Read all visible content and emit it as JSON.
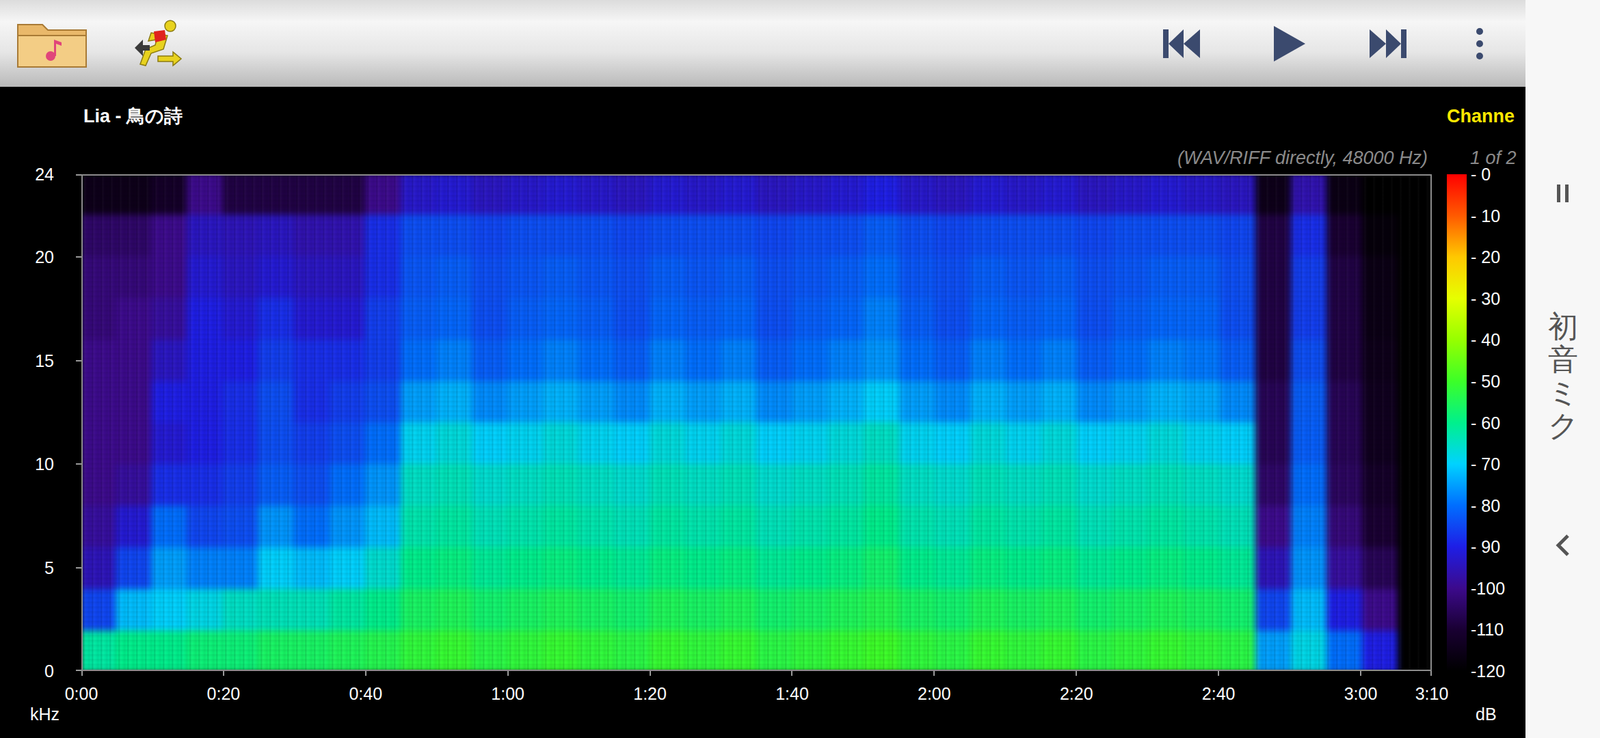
{
  "title": "Lia - 鳥の詩",
  "channel_label": "Channe",
  "source_info": "(WAV/RIFF directly, 48000 Hz)",
  "channel_index": "1 of 2",
  "chart": {
    "y_axis": {
      "unit": "kHz",
      "ticks": [
        "24",
        "20",
        "15",
        "10",
        "5",
        "0"
      ]
    },
    "x_axis": {
      "ticks": [
        "0:00",
        "0:20",
        "0:40",
        "1:00",
        "1:20",
        "1:40",
        "2:00",
        "2:20",
        "2:40",
        "3:00",
        "3:10"
      ]
    },
    "colorbar": {
      "unit": "dB",
      "ticks": [
        "- 0",
        "- 10",
        "- 20",
        "- 30",
        "- 40",
        "- 50",
        "- 60",
        "- 70",
        "- 80",
        "- 90",
        "-100",
        "-110",
        "-120"
      ]
    },
    "spectrogram": {
      "columns": [
        [
          -62,
          -85,
          -95,
          -98,
          -100,
          -100,
          -100,
          -100,
          -102,
          -102,
          -104,
          -115
        ],
        [
          -60,
          -72,
          -85,
          -92,
          -98,
          -100,
          -100,
          -100,
          -100,
          -102,
          -104,
          -115
        ],
        [
          -60,
          -70,
          -75,
          -80,
          -88,
          -92,
          -90,
          -94,
          -98,
          -100,
          -100,
          -112
        ],
        [
          -58,
          -68,
          -78,
          -85,
          -88,
          -90,
          -90,
          -90,
          -90,
          -92,
          -94,
          -100
        ],
        [
          -58,
          -65,
          -78,
          -84,
          -86,
          -88,
          -88,
          -90,
          -92,
          -94,
          -95,
          -108
        ],
        [
          -56,
          -64,
          -70,
          -76,
          -82,
          -84,
          -84,
          -86,
          -88,
          -92,
          -94,
          -108
        ],
        [
          -56,
          -64,
          -72,
          -80,
          -84,
          -86,
          -88,
          -88,
          -92,
          -94,
          -96,
          -108
        ],
        [
          -55,
          -62,
          -70,
          -76,
          -80,
          -84,
          -86,
          -88,
          -92,
          -94,
          -96,
          -108
        ],
        [
          -54,
          -60,
          -66,
          -72,
          -76,
          -80,
          -84,
          -86,
          -86,
          -88,
          -88,
          -100
        ],
        [
          -52,
          -56,
          -60,
          -63,
          -65,
          -69,
          -75,
          -80,
          -82,
          -83,
          -84,
          -93
        ],
        [
          -51,
          -55,
          -59,
          -62,
          -64,
          -67,
          -73,
          -78,
          -81,
          -82,
          -84,
          -92
        ],
        [
          -53,
          -57,
          -61,
          -64,
          -66,
          -70,
          -77,
          -82,
          -84,
          -84,
          -85,
          -94
        ],
        [
          -52,
          -56,
          -60,
          -63,
          -65,
          -69,
          -75,
          -80,
          -82,
          -83,
          -84,
          -93
        ],
        [
          -51,
          -55,
          -59,
          -62,
          -64,
          -67,
          -73,
          -78,
          -81,
          -82,
          -84,
          -92
        ],
        [
          -52,
          -56,
          -60,
          -63,
          -65,
          -69,
          -75,
          -80,
          -82,
          -83,
          -84,
          -93
        ],
        [
          -53,
          -57,
          -61,
          -64,
          -66,
          -70,
          -77,
          -82,
          -84,
          -84,
          -85,
          -94
        ],
        [
          -51,
          -55,
          -59,
          -62,
          -64,
          -67,
          -73,
          -78,
          -81,
          -82,
          -84,
          -92
        ],
        [
          -52,
          -56,
          -60,
          -63,
          -65,
          -69,
          -75,
          -80,
          -82,
          -83,
          -84,
          -93
        ],
        [
          -51,
          -55,
          -59,
          -62,
          -64,
          -67,
          -73,
          -78,
          -81,
          -82,
          -84,
          -92
        ],
        [
          -53,
          -57,
          -61,
          -64,
          -66,
          -70,
          -77,
          -82,
          -84,
          -84,
          -85,
          -94
        ],
        [
          -52,
          -56,
          -60,
          -63,
          -65,
          -69,
          -75,
          -80,
          -82,
          -83,
          -84,
          -93
        ],
        [
          -51,
          -55,
          -59,
          -62,
          -64,
          -67,
          -73,
          -78,
          -81,
          -82,
          -84,
          -92
        ],
        [
          -50,
          -54,
          -57,
          -60,
          -62,
          -65,
          -70,
          -76,
          -78,
          -80,
          -82,
          -90
        ],
        [
          -52,
          -56,
          -60,
          -63,
          -65,
          -69,
          -75,
          -80,
          -82,
          -83,
          -84,
          -93
        ],
        [
          -53,
          -57,
          -61,
          -64,
          -66,
          -70,
          -77,
          -82,
          -84,
          -84,
          -85,
          -94
        ],
        [
          -51,
          -55,
          -59,
          -62,
          -64,
          -67,
          -73,
          -78,
          -81,
          -82,
          -84,
          -92
        ],
        [
          -52,
          -56,
          -60,
          -63,
          -65,
          -69,
          -75,
          -80,
          -82,
          -83,
          -84,
          -93
        ],
        [
          -51,
          -55,
          -59,
          -62,
          -64,
          -67,
          -73,
          -78,
          -81,
          -82,
          -84,
          -92
        ],
        [
          -53,
          -57,
          -61,
          -64,
          -66,
          -70,
          -77,
          -82,
          -84,
          -84,
          -85,
          -94
        ],
        [
          -52,
          -56,
          -60,
          -63,
          -65,
          -69,
          -75,
          -80,
          -82,
          -83,
          -84,
          -93
        ],
        [
          -51,
          -55,
          -59,
          -62,
          -64,
          -67,
          -73,
          -78,
          -81,
          -82,
          -84,
          -92
        ],
        [
          -52,
          -56,
          -60,
          -63,
          -65,
          -69,
          -74,
          -79,
          -81,
          -82,
          -84,
          -93
        ],
        [
          -53,
          -57,
          -61,
          -64,
          -66,
          -70,
          -77,
          -82,
          -84,
          -84,
          -85,
          -94
        ],
        [
          -75,
          -85,
          -95,
          -100,
          -104,
          -106,
          -106,
          -108,
          -108,
          -108,
          -108,
          -115
        ],
        [
          -68,
          -72,
          -76,
          -78,
          -80,
          -82,
          -82,
          -84,
          -86,
          -86,
          -88,
          -96
        ],
        [
          -80,
          -90,
          -98,
          -102,
          -105,
          -106,
          -106,
          -108,
          -108,
          -108,
          -110,
          -116
        ],
        [
          -90,
          -100,
          -106,
          -110,
          -112,
          -114,
          -114,
          -115,
          -116,
          -116,
          -118,
          -120
        ],
        [
          -120,
          -120,
          -120,
          -120,
          -120,
          -120,
          -120,
          -120,
          -120,
          -120,
          -120,
          -120
        ]
      ]
    }
  },
  "side_panel": {
    "label": "初音ミク"
  }
}
